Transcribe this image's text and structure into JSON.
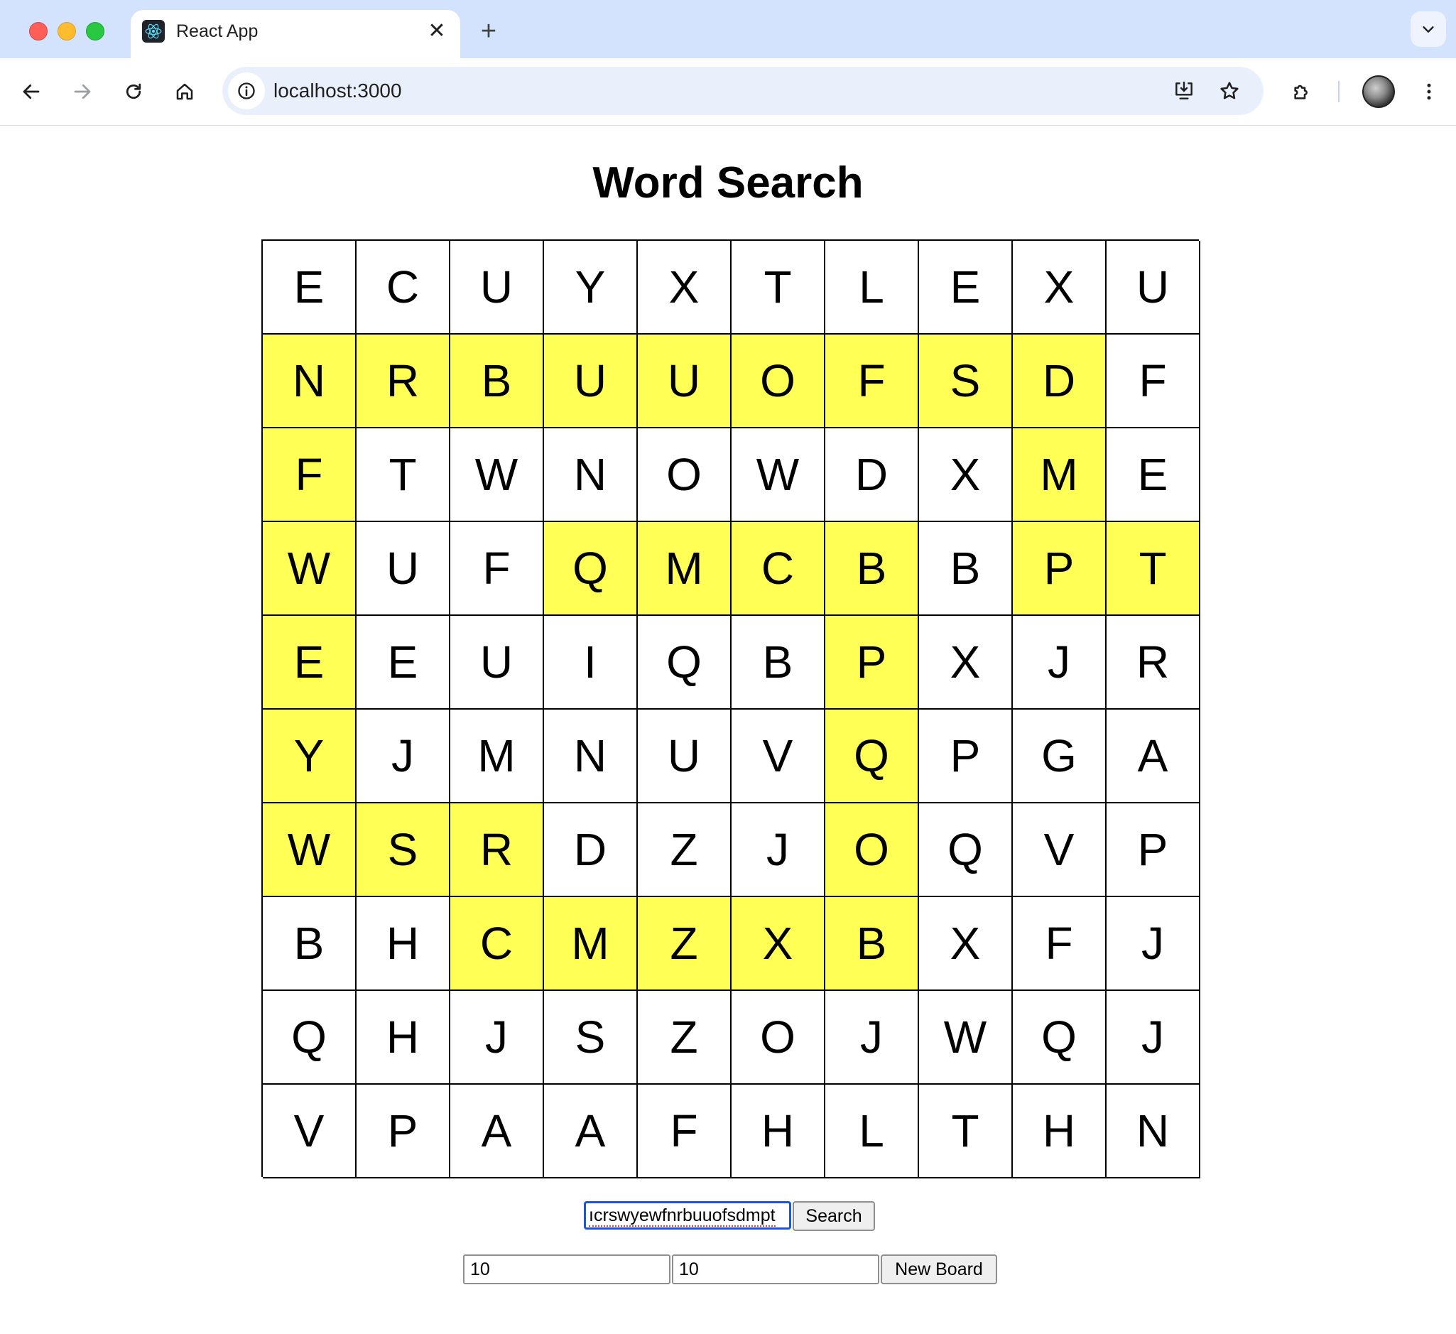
{
  "browser": {
    "tab_title": "React App",
    "new_tab_symbol": "+",
    "close_symbol": "✕",
    "url": "localhost:3000",
    "icons": [
      "react-favicon-icon",
      "close-icon",
      "plus-icon",
      "chevron-down-icon",
      "back-icon",
      "forward-icon",
      "reload-icon",
      "home-icon",
      "info-icon",
      "install-icon",
      "star-icon",
      "extensions-icon",
      "avatar",
      "more-icon"
    ]
  },
  "page": {
    "title": "Word Search"
  },
  "grid": {
    "rows": [
      [
        "E",
        "C",
        "U",
        "Y",
        "X",
        "T",
        "L",
        "E",
        "X",
        "U"
      ],
      [
        "N",
        "R",
        "B",
        "U",
        "U",
        "O",
        "F",
        "S",
        "D",
        "F"
      ],
      [
        "F",
        "T",
        "W",
        "N",
        "O",
        "W",
        "D",
        "X",
        "M",
        "E"
      ],
      [
        "W",
        "U",
        "F",
        "Q",
        "M",
        "C",
        "B",
        "B",
        "P",
        "T"
      ],
      [
        "E",
        "E",
        "U",
        "I",
        "Q",
        "B",
        "P",
        "X",
        "J",
        "R"
      ],
      [
        "Y",
        "J",
        "M",
        "N",
        "U",
        "V",
        "Q",
        "P",
        "G",
        "A"
      ],
      [
        "W",
        "S",
        "R",
        "D",
        "Z",
        "J",
        "O",
        "Q",
        "V",
        "P"
      ],
      [
        "B",
        "H",
        "C",
        "M",
        "Z",
        "X",
        "B",
        "X",
        "F",
        "J"
      ],
      [
        "Q",
        "H",
        "J",
        "S",
        "Z",
        "O",
        "J",
        "W",
        "Q",
        "J"
      ],
      [
        "V",
        "P",
        "A",
        "A",
        "F",
        "H",
        "L",
        "T",
        "H",
        "N"
      ]
    ],
    "highlighted": [
      [
        1,
        0
      ],
      [
        1,
        1
      ],
      [
        1,
        2
      ],
      [
        1,
        3
      ],
      [
        1,
        4
      ],
      [
        1,
        5
      ],
      [
        1,
        6
      ],
      [
        1,
        7
      ],
      [
        1,
        8
      ],
      [
        2,
        0
      ],
      [
        2,
        8
      ],
      [
        3,
        0
      ],
      [
        3,
        3
      ],
      [
        3,
        4
      ],
      [
        3,
        5
      ],
      [
        3,
        6
      ],
      [
        3,
        8
      ],
      [
        3,
        9
      ],
      [
        4,
        0
      ],
      [
        4,
        6
      ],
      [
        5,
        0
      ],
      [
        5,
        6
      ],
      [
        6,
        0
      ],
      [
        6,
        1
      ],
      [
        6,
        2
      ],
      [
        6,
        6
      ],
      [
        7,
        2
      ],
      [
        7,
        3
      ],
      [
        7,
        4
      ],
      [
        7,
        5
      ],
      [
        7,
        6
      ]
    ],
    "highlight_color": "#ffff55"
  },
  "search": {
    "value": "ıcrswyewfnrbuuofsdmpt",
    "button_label": "Search"
  },
  "new_board": {
    "rows_value": "10",
    "cols_value": "10",
    "button_label": "New Board"
  }
}
